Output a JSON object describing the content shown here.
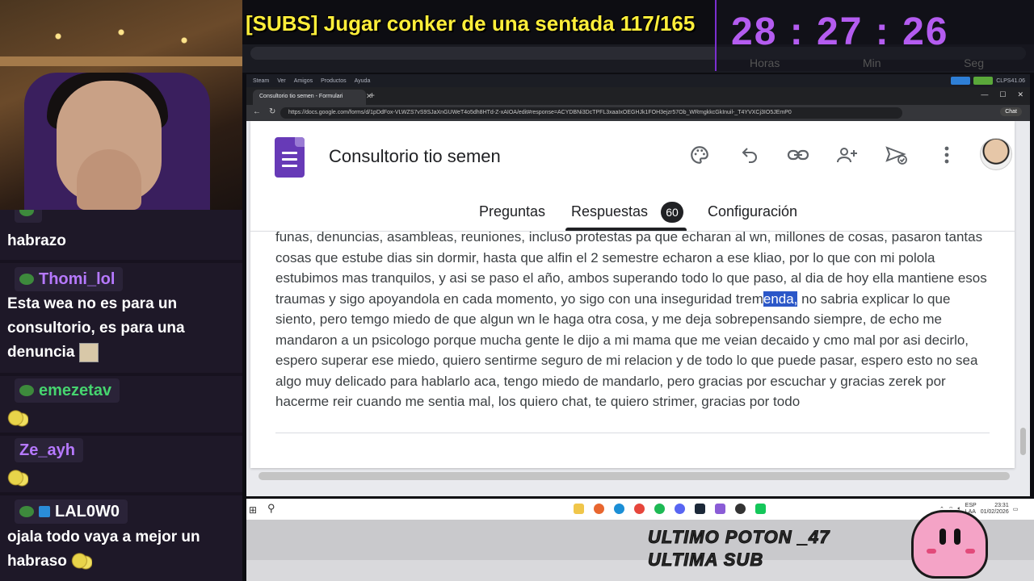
{
  "stream": {
    "title": "[SUBS] Jugar conker de una sentada 117/165",
    "timer": "28 : 27 : 26",
    "timer_labels": [
      "Horas",
      "Min",
      "Seg"
    ]
  },
  "chat": {
    "messages": [
      {
        "user": "",
        "text": "habrazo"
      },
      {
        "user": "Thomi_lol",
        "user_color": "#b679ff",
        "lines": [
          "Esta wea no es para un",
          "consultorio, es para una",
          "denuncia"
        ]
      },
      {
        "user": "emezetav",
        "user_color": "#46d46f",
        "text": ""
      },
      {
        "user": "Ze_ayh",
        "user_color": "#b679ff",
        "text": ""
      },
      {
        "user": "LAL0W0",
        "user_color": "#ffffff",
        "lines": [
          "ojala todo vaya a mejor un",
          "habraso"
        ]
      }
    ]
  },
  "steam_bar": {
    "items": [
      "Steam",
      "Ver",
      "Amigos",
      "Productos",
      "Ayuda"
    ],
    "user": "CLPS41.06"
  },
  "browser": {
    "tab_title": "Consultorio tio semen - Formulari",
    "url": "https://docs.google.com/forms/d/1pDdFox-VLWZS7vS9SJaXnGUWeT4o5dh8HTd-Z-xAIOA/edit#response=ACYDBNi3DcTPFL3xaaIxOEGHJk1FOH3ejzr57Ob_WRmgkkcGkInuil-_T4YVXCj3IO5JEmP0",
    "chat_label": "Chat"
  },
  "form": {
    "title": "Consultorio tio semen",
    "tabs": {
      "questions": "Preguntas",
      "responses": "Respuestas",
      "settings": "Configuración"
    },
    "response_count": "60",
    "response_before": "funas, denuncias, asambleas, reuniones, incluso protestas pa que echaran al wn, millones de cosas, pasaron tantas cosas que estube dias sin dormir, hasta que alfin el 2 semestre echaron a ese kliao, por lo que con mi polola estubimos mas tranquilos, y asi se paso el año, ambos superando todo lo que paso, al dia de hoy ella mantiene esos traumas y sigo apoyandola en cada momento, yo sigo con una inseguridad trem",
    "response_highlight": "enda,",
    "response_after": " no sabria explicar lo que siento, pero temgo miedo de que algun wn le haga otra cosa, y me deja sobrepensando siempre, de echo me mandaron a un psicologo porque mucha gente le dijo a mi mama que me veian decaido y cmo mal por asi decirlo, espero superar ese miedo, quiero sentirme seguro de mi relacion y de todo lo que puede pasar, espero esto no sea algo muy delicado para hablarlo aca, tengo miedo de mandarlo, pero gracias por escuchar y gracias zerek por hacerme reir cuando me sentia mal, los quiero chat, te quiero strimer, gracias por todo"
  },
  "taskbar": {
    "lang": "ESP",
    "region": "LAA",
    "time": "23:31",
    "date": "01/02/2026"
  },
  "overlay": {
    "line1": "ULTIMO POTON _47",
    "line2": "ULTIMA SUB"
  },
  "colors": {
    "title_yellow": "#ffef3a",
    "timer_purple": "#b45cf0",
    "forms_purple": "#673ab7",
    "highlight_blue": "#2b57c8"
  }
}
